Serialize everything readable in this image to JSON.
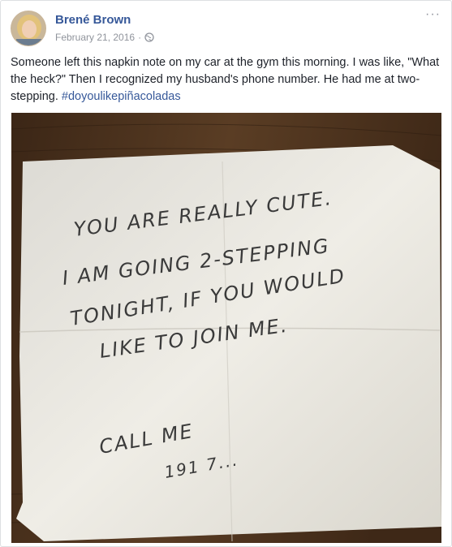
{
  "post": {
    "author": "Brené Brown",
    "date": "February 21, 2016",
    "meta_separator": "·",
    "privacy_icon": "globe-icon",
    "more_icon": "more-options-icon",
    "more_label": "···",
    "text": "Someone left this napkin note on my car at the gym this morning. I was like, \"What the heck?\" Then I recognized my husband's phone number. He had me at two-stepping. ",
    "hashtag": "#doyoulikepiñacoladas"
  },
  "photo": {
    "note_lines": [
      "YOU ARE REALLY CUTE.",
      "I AM GOING 2-STEPPING",
      "TONIGHT, IF YOU WOULD",
      "LIKE TO JOIN ME.",
      "CALL ME",
      "191 7..."
    ]
  },
  "colors": {
    "link_blue": "#365899",
    "text": "#1d2129",
    "meta_gray": "#90949c",
    "wood": "#4a3220",
    "napkin": "#e9e7e0"
  }
}
